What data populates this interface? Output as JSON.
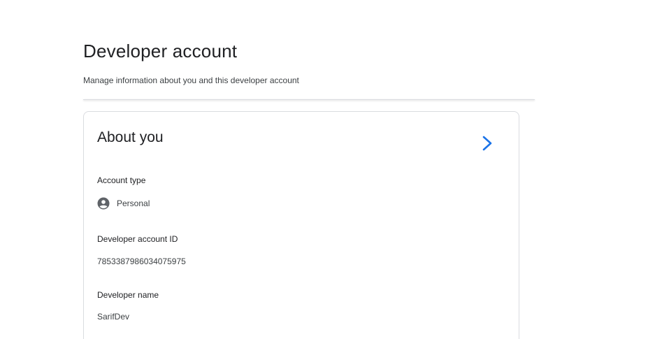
{
  "header": {
    "title": "Developer account",
    "subtitle": "Manage information about you and this developer account"
  },
  "about_card": {
    "title": "About you",
    "chevron_icon": "chevron-right-icon",
    "accent_color": "#1a73e8",
    "fields": {
      "account_type": {
        "label": "Account type",
        "value": "Personal",
        "icon": "account-circle-icon"
      },
      "developer_account_id": {
        "label": "Developer account ID",
        "value": "7853387986034075975"
      },
      "developer_name": {
        "label": "Developer name",
        "value": "SarifDev"
      }
    }
  }
}
